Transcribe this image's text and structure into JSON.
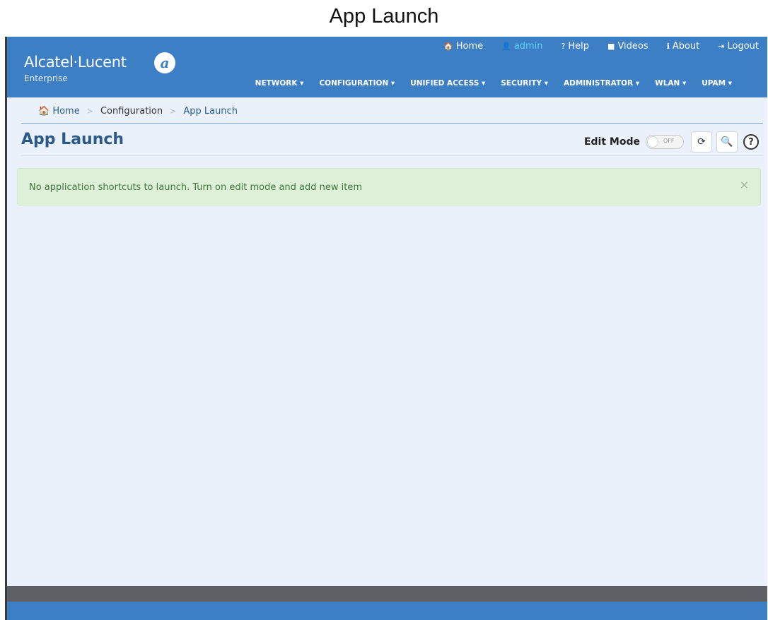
{
  "doc_title": "App Launch",
  "brand": {
    "name": "Alcatel·Lucent",
    "sub": "Enterprise",
    "mark": "a"
  },
  "util_nav": [
    {
      "icon": "home-icon",
      "glyph": "🏠",
      "label": "Home"
    },
    {
      "icon": "user-icon",
      "glyph": "👤",
      "label": "admin"
    },
    {
      "icon": "help-icon",
      "glyph": "?",
      "label": "Help"
    },
    {
      "icon": "video-icon",
      "glyph": "■",
      "label": "Videos"
    },
    {
      "icon": "info-icon",
      "glyph": "ℹ",
      "label": "About"
    },
    {
      "icon": "logout-icon",
      "glyph": "⇥",
      "label": "Logout"
    }
  ],
  "main_nav": [
    "NETWORK ▾",
    "CONFIGURATION ▾",
    "UNIFIED ACCESS ▾",
    "SECURITY ▾",
    "ADMINISTRATOR ▾",
    "WLAN ▾",
    "UPAM ▾"
  ],
  "breadcrumb": {
    "home": "Home",
    "section": "Configuration",
    "current": "App Launch",
    "sep": ">"
  },
  "page": {
    "title": "App Launch",
    "edit_mode_label": "Edit Mode",
    "toggle_state": "OFF",
    "refresh_glyph": "⟳",
    "search_glyph": "🔍",
    "help_glyph": "?"
  },
  "alert": {
    "message": "No application shortcuts to launch. Turn on edit mode and add new item",
    "close": "×"
  },
  "colors": {
    "header": "#3d7fc4",
    "admin": "#5fd0f5",
    "alert_bg": "#dff0d8",
    "alert_text": "#3c763d"
  }
}
